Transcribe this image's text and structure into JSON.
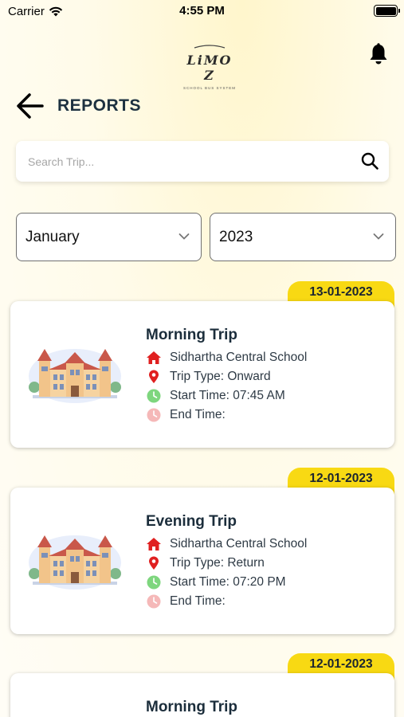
{
  "status_bar": {
    "carrier": "Carrier",
    "time": "4:55 PM"
  },
  "brand": {
    "logo_text": "LiMO Z",
    "tagline": "SCHOOL BUS SYSTEM"
  },
  "header": {
    "title": "REPORTS"
  },
  "search": {
    "placeholder": "Search Trip..."
  },
  "filters": {
    "month": "January",
    "year": "2023"
  },
  "colors": {
    "accent_yellow": "#f8d913",
    "home_red": "#e02020",
    "pin_red": "#e02020",
    "clock_green": "#7ed67e",
    "clock_pink": "#f5b8b8"
  },
  "trips": [
    {
      "date": "13-01-2023",
      "title": "Morning Trip",
      "school": "Sidhartha Central School",
      "trip_type": "Trip Type: Onward",
      "start_time": "Start Time: 07:45 AM",
      "end_time": "End Time:"
    },
    {
      "date": "12-01-2023",
      "title": "Evening Trip",
      "school": "Sidhartha Central School",
      "trip_type": "Trip Type: Return",
      "start_time": "Start Time: 07:20 PM",
      "end_time": "End Time:"
    },
    {
      "date": "12-01-2023",
      "title": "Morning Trip"
    }
  ]
}
